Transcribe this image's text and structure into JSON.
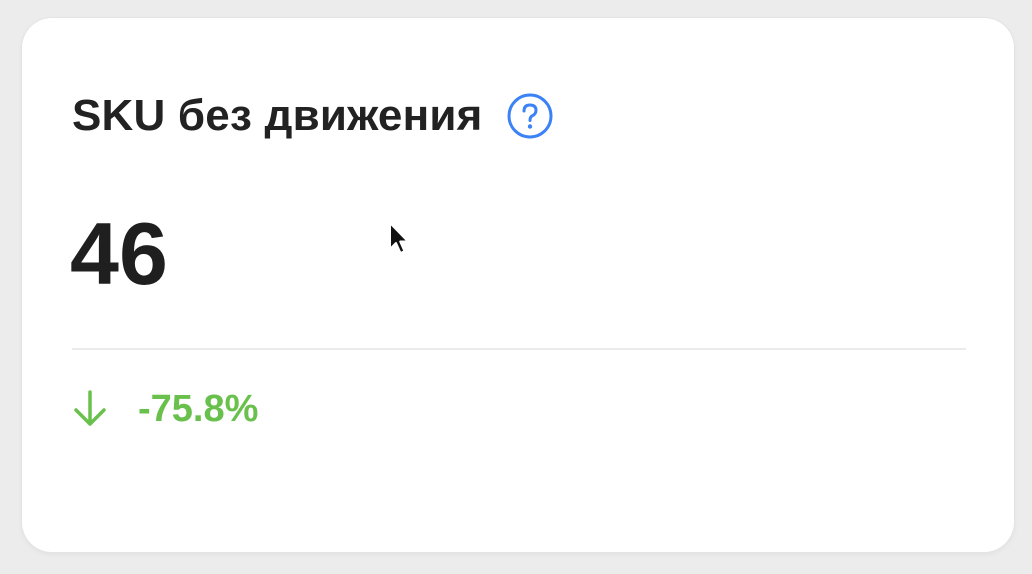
{
  "card": {
    "title": "SKU без движения",
    "value": "46",
    "change": "-75.8%"
  },
  "icons": {
    "help": "question-circle-icon",
    "change_direction": "arrow-down-icon",
    "cursor": "mouse-pointer-icon"
  },
  "colors": {
    "accent": "#3b82f6",
    "positive_change": "#6ac04c",
    "text": "#222222",
    "card_background": "#ffffff",
    "page_background": "#ececec"
  }
}
